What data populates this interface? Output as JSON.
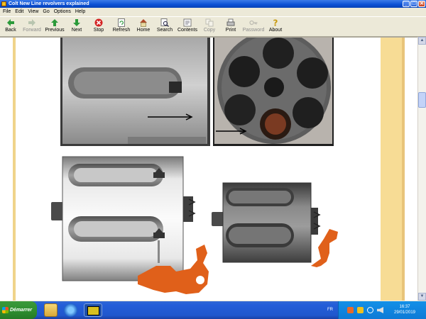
{
  "window": {
    "title": "Colt New Line revolvers explained",
    "min_glyph": "_",
    "max_glyph": "□",
    "close_glyph": "✕"
  },
  "menu": [
    "File",
    "Edit",
    "View",
    "Go",
    "Options",
    "Help"
  ],
  "toolbar": [
    {
      "label": "Back",
      "icon": "arrow-left-icon",
      "enabled": true
    },
    {
      "label": "Forward",
      "icon": "arrow-right-icon",
      "enabled": false
    },
    {
      "label": "Previous",
      "icon": "arrow-up-icon",
      "enabled": true
    },
    {
      "label": "Next",
      "icon": "arrow-down-icon",
      "enabled": true
    },
    {
      "label": "Stop",
      "icon": "stop-icon",
      "enabled": true
    },
    {
      "label": "Refresh",
      "icon": "refresh-icon",
      "enabled": true
    },
    {
      "label": "Home",
      "icon": "home-icon",
      "enabled": true
    },
    {
      "label": "Search",
      "icon": "search-icon",
      "enabled": true
    },
    {
      "label": "Contents",
      "icon": "contents-icon",
      "enabled": true
    },
    {
      "label": "Copy",
      "icon": "copy-icon",
      "enabled": false
    },
    {
      "label": "Print",
      "icon": "print-icon",
      "enabled": true
    },
    {
      "label": "Password",
      "icon": "key-icon",
      "enabled": false
    },
    {
      "label": "About",
      "icon": "help-icon",
      "enabled": true
    }
  ],
  "colors": {
    "page_band": "#f7dc95",
    "diagram_part": "#e0601a",
    "cylinder_dark": "#5a5a5a",
    "cylinder_light": "#f2f2f2"
  },
  "taskbar": {
    "start_label": "Démarrer",
    "language": "FR",
    "time": "16:37",
    "date": "29/01/2019"
  }
}
